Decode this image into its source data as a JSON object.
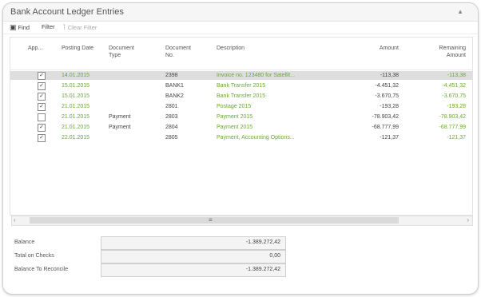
{
  "window": {
    "title": "Bank Account Ledger Entries",
    "collapse_icon": "chevron-up-icon"
  },
  "actions": {
    "find": "Find",
    "filter": "Filter",
    "clear_filter": "Clear Filter"
  },
  "columns": [
    "App...",
    "Posting Date",
    "Document Type",
    "Document No.",
    "Description",
    "Amount",
    "Remaining Amount"
  ],
  "rows": [
    {
      "applied": true,
      "posting_date": "14.01.2015",
      "doc_type": "",
      "doc_no": "2398",
      "description": "Invoice no. 123480 for Satellit...",
      "amount": "-113,38",
      "remaining": "-113,38",
      "selected": true
    },
    {
      "applied": true,
      "posting_date": "15.01.2015",
      "doc_type": "",
      "doc_no": "BANK1",
      "description": "Bank Transfer 2015",
      "amount": "-4.451,32",
      "remaining": "-4.451,32",
      "selected": false
    },
    {
      "applied": true,
      "posting_date": "15.01.2015",
      "doc_type": "",
      "doc_no": "BANK2",
      "description": "Bank Transfer 2015",
      "amount": "-3.670,75",
      "remaining": "-3.670,75",
      "selected": false
    },
    {
      "applied": true,
      "posting_date": "21.01.2015",
      "doc_type": "",
      "doc_no": "2801",
      "description": "Postage 2015",
      "amount": "-193,28",
      "remaining": "-193,28",
      "selected": false
    },
    {
      "applied": false,
      "posting_date": "21.01.2015",
      "doc_type": "Payment",
      "doc_no": "2803",
      "description": "Payment 2015",
      "amount": "-78.903,42",
      "remaining": "-78.903,42",
      "selected": false
    },
    {
      "applied": true,
      "posting_date": "21.01.2015",
      "doc_type": "Payment",
      "doc_no": "2804",
      "description": "Payment 2015",
      "amount": "-68.777,99",
      "remaining": "-68.777,99",
      "selected": false
    },
    {
      "applied": true,
      "posting_date": "22.01.2015",
      "doc_type": "",
      "doc_no": "2805",
      "description": "Payment, Accounting Options...",
      "amount": "-121,37",
      "remaining": "-121,37",
      "selected": false
    }
  ],
  "summary": [
    {
      "label": "Balance",
      "value": "-1.389.272,42"
    },
    {
      "label": "Total on Checks",
      "value": "0,00"
    },
    {
      "label": "Balance To Reconcile",
      "value": "-1.389.272,42"
    }
  ],
  "colors": {
    "accent_green": "#6aa832",
    "selected_row": "#dedede"
  }
}
